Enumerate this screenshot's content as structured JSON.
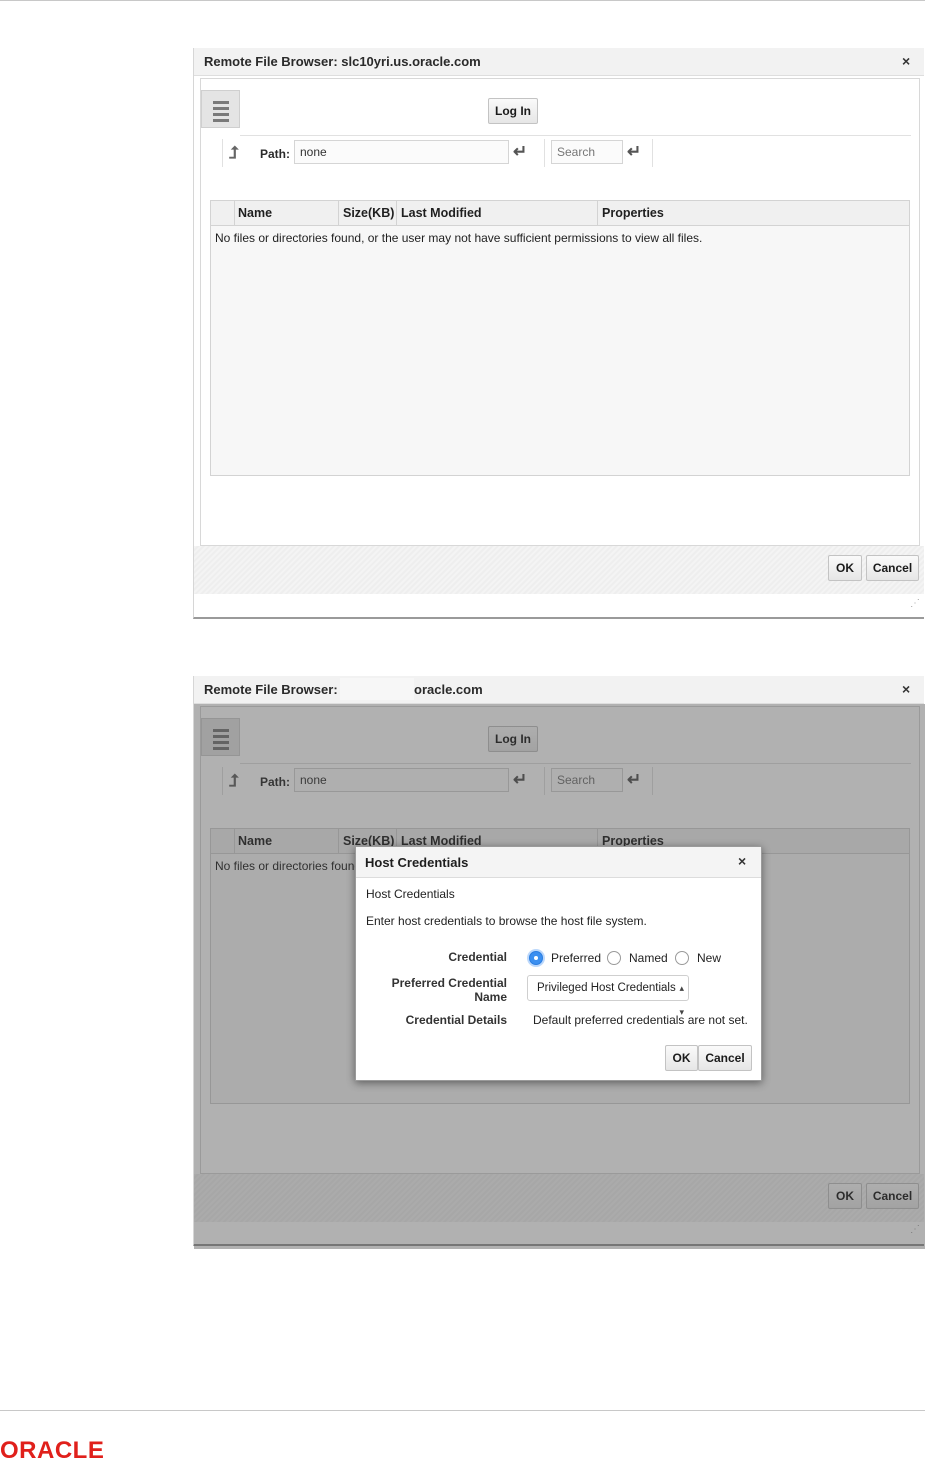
{
  "dialog1": {
    "title": "Remote File Browser: slc10yri.us.oracle.com",
    "close_glyph": "×",
    "menu_icon": "hamburger-menu-icon",
    "login_label": "Log In",
    "up_icon": "up-arrow-icon",
    "path_label": "Path:",
    "path_value": "none",
    "enter_glyph": "↵",
    "search_placeholder": "Search",
    "columns": [
      "Name",
      "Size(KB)",
      "Last Modified",
      "Properties"
    ],
    "empty_message": "No files or directories found, or the user may not have sufficient permissions to view all files.",
    "ok_label": "OK",
    "cancel_label": "Cancel",
    "resize_glyph": "⋰"
  },
  "dialog2": {
    "title_prefix": "Remote File Browser:",
    "title_suffix": "oracle.com",
    "close_glyph": "×",
    "login_label": "Log In",
    "path_label": "Path:",
    "path_value": "none",
    "enter_glyph": "↵",
    "search_placeholder": "Search",
    "columns": [
      "Name",
      "Size(KB)",
      "Last Modified",
      "Properties"
    ],
    "empty_message": "No files or directories found, or the user may not have sufficient permissions to view all files.",
    "ok_label": "OK",
    "cancel_label": "Cancel",
    "resize_glyph": "⋰"
  },
  "host_credentials": {
    "title": "Host Credentials",
    "close_glyph": "×",
    "section_heading": "Host Credentials",
    "instruction": "Enter host credentials to browse the host file system.",
    "credential_label": "Credential",
    "options": [
      {
        "label": "Preferred",
        "selected": true
      },
      {
        "label": "Named",
        "selected": false
      },
      {
        "label": "New",
        "selected": false
      }
    ],
    "preferred_name_label_line1": "Preferred Credential",
    "preferred_name_label_line2": "Name",
    "preferred_name_value": "Privileged Host Credentials",
    "select_arrow": "▲▼",
    "details_label": "Credential Details",
    "details_value": "Default preferred credentials are not set.",
    "ok_label": "OK",
    "cancel_label": "Cancel"
  },
  "footer": {
    "logo_text": "ORACLE",
    "logo_color": "#e0201b"
  },
  "colors": {
    "radio_selected": "#3b8ff0",
    "overlay": "#464646"
  }
}
